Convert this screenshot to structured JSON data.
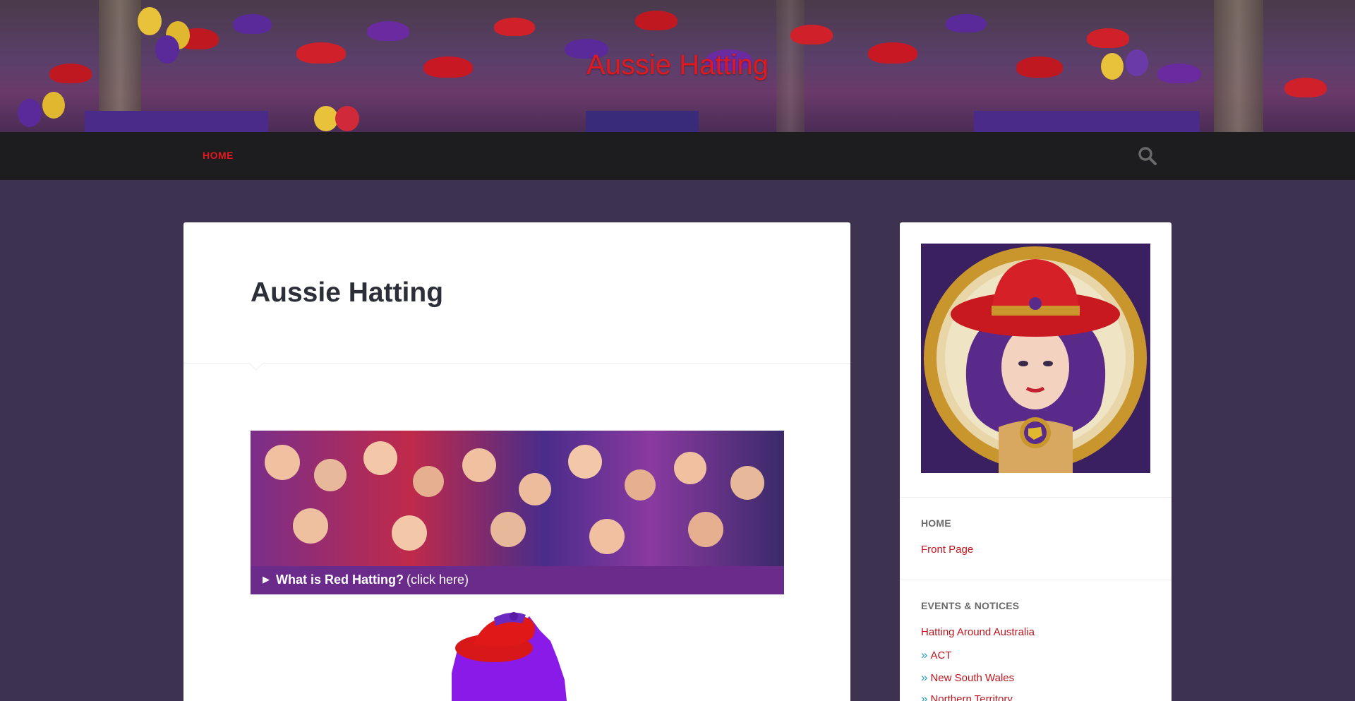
{
  "site": {
    "title": "Aussie Hatting"
  },
  "nav": {
    "home_label": "HOME",
    "search_icon": "search-icon"
  },
  "main": {
    "page_title": "Aussie Hatting",
    "details_marker": "▶",
    "details_label": "What is Red Hatting?",
    "details_hint": "(click here)"
  },
  "sidebar": {
    "home_widget": {
      "title": "HOME",
      "links": [
        "Front Page"
      ]
    },
    "events_widget": {
      "title": "EVENTS & NOTICES",
      "link": "Hatting Around Australia",
      "sub_links": [
        "ACT",
        "New South Wales",
        "Northern Territory"
      ]
    }
  },
  "colors": {
    "accent_red": "#e0191e",
    "link_red": "#c0141c",
    "nav_bg": "#1d1d1f",
    "page_bg": "#3d3250",
    "details_bg": "#6a2b8a"
  }
}
